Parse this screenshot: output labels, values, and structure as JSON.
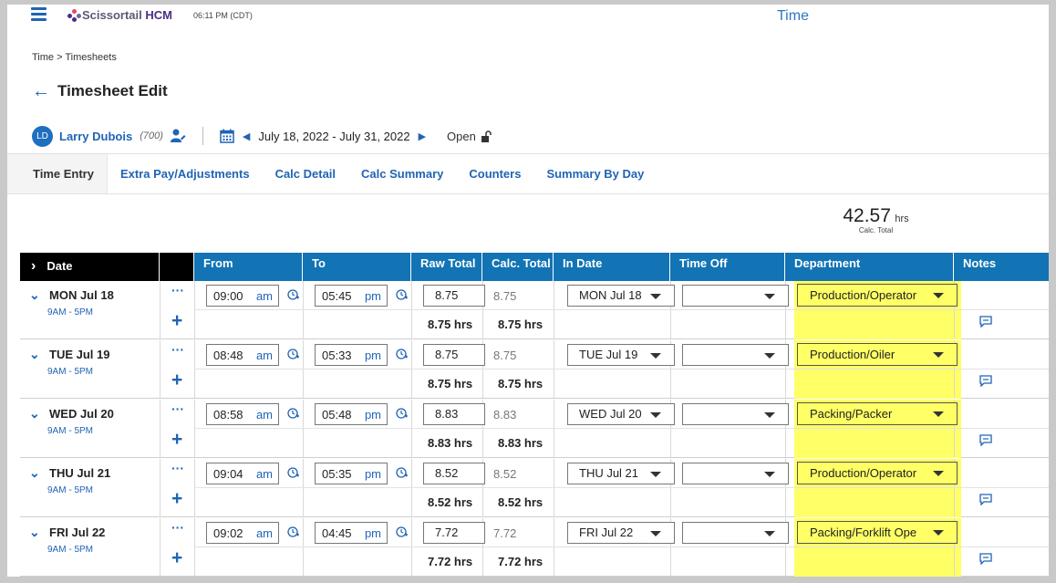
{
  "header": {
    "brand_prefix": "Scissortail",
    "brand_suffix": "HCM",
    "clock": "06:11 PM (CDT)",
    "app_title": "Time"
  },
  "breadcrumb": "Time > Timesheets",
  "page_title": "Timesheet Edit",
  "employee": {
    "initials": "LD",
    "name": "Larry Dubois",
    "id": "(700)",
    "date_range": "July 18, 2022 - July 31, 2022",
    "status": "Open"
  },
  "tabs": [
    "Time Entry",
    "Extra Pay/Adjustments",
    "Calc Detail",
    "Calc Summary",
    "Counters",
    "Summary By Day"
  ],
  "total": {
    "value": "42.57",
    "unit": "hrs",
    "label": "Calc. Total"
  },
  "columns": {
    "date": "Date",
    "from": "From",
    "to": "To",
    "raw_total": "Raw Total",
    "calc_total": "Calc. Total",
    "in_date": "In Date",
    "time_off": "Time Off",
    "department": "Department",
    "notes": "Notes"
  },
  "rows": [
    {
      "day": "MON Jul 18",
      "shift": "9AM - 5PM",
      "from_time": "09:00",
      "from_ampm": "am",
      "to_time": "05:45",
      "to_ampm": "pm",
      "raw": "8.75",
      "calc": "8.75",
      "raw_sum": "8.75 hrs",
      "calc_sum": "8.75 hrs",
      "in_date": "MON Jul 18",
      "time_off": "",
      "department": "Production/Operator"
    },
    {
      "day": "TUE Jul 19",
      "shift": "9AM - 5PM",
      "from_time": "08:48",
      "from_ampm": "am",
      "to_time": "05:33",
      "to_ampm": "pm",
      "raw": "8.75",
      "calc": "8.75",
      "raw_sum": "8.75 hrs",
      "calc_sum": "8.75 hrs",
      "in_date": "TUE Jul 19",
      "time_off": "",
      "department": "Production/Oiler"
    },
    {
      "day": "WED Jul 20",
      "shift": "9AM - 5PM",
      "from_time": "08:58",
      "from_ampm": "am",
      "to_time": "05:48",
      "to_ampm": "pm",
      "raw": "8.83",
      "calc": "8.83",
      "raw_sum": "8.83 hrs",
      "calc_sum": "8.83 hrs",
      "in_date": "WED Jul 20",
      "time_off": "",
      "department": "Packing/Packer"
    },
    {
      "day": "THU Jul 21",
      "shift": "9AM - 5PM",
      "from_time": "09:04",
      "from_ampm": "am",
      "to_time": "05:35",
      "to_ampm": "pm",
      "raw": "8.52",
      "calc": "8.52",
      "raw_sum": "8.52 hrs",
      "calc_sum": "8.52 hrs",
      "in_date": "THU Jul 21",
      "time_off": "",
      "department": "Production/Operator"
    },
    {
      "day": "FRI Jul 22",
      "shift": "9AM - 5PM",
      "from_time": "09:02",
      "from_ampm": "am",
      "to_time": "04:45",
      "to_ampm": "pm",
      "raw": "7.72",
      "calc": "7.72",
      "raw_sum": "7.72 hrs",
      "calc_sum": "7.72 hrs",
      "in_date": "FRI Jul 22",
      "time_off": "",
      "department": "Packing/Forklift Ope"
    }
  ],
  "colors": {
    "accent": "#1f64b5",
    "header_blue": "#1273b5",
    "highlight": "#ffff66"
  }
}
